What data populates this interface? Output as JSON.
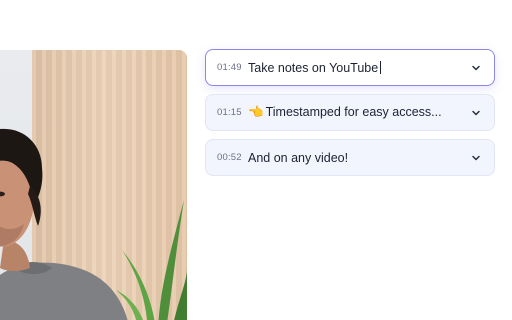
{
  "notes": [
    {
      "timestamp": "01:49",
      "text": "Take notes on YouTube",
      "emoji": "",
      "active": true
    },
    {
      "timestamp": "01:15",
      "text": "Timestamped for easy access...",
      "emoji": "👈",
      "active": false
    },
    {
      "timestamp": "00:52",
      "text": "And on any video!",
      "emoji": "",
      "active": false
    }
  ],
  "colors": {
    "accent_border": "#8e86e6",
    "note_bg": "#f2f5fd",
    "timestamp": "#6a6f86"
  },
  "icons": {
    "expand": "chevron-down-icon",
    "pointer_emoji": "pointing-hand-icon"
  }
}
